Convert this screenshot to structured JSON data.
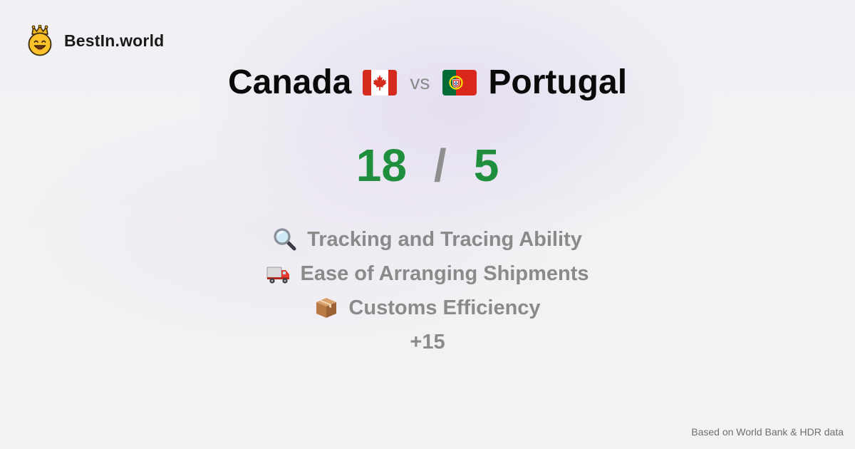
{
  "brand": {
    "name": "BestIn.world",
    "logo_icon": "crown-smiley-icon"
  },
  "comparison": {
    "country_a": {
      "name": "Canada",
      "flag_icon": "canada-flag-icon"
    },
    "vs_label": "vs",
    "country_b": {
      "name": "Portugal",
      "flag_icon": "portugal-flag-icon"
    }
  },
  "score": {
    "a": "18",
    "separator": "/",
    "b": "5"
  },
  "categories": [
    {
      "icon": "magnifying-glass-icon",
      "label": "Tracking and Tracing Ability"
    },
    {
      "icon": "delivery-truck-icon",
      "label": "Ease of Arranging Shipments"
    },
    {
      "icon": "package-box-icon",
      "label": "Customs Efficiency"
    }
  ],
  "more_label": "+15",
  "footer": {
    "source": "Based on World Bank & HDR data"
  },
  "colors": {
    "score_green": "#1f8f3d",
    "muted_gray": "#8a8a8a",
    "title_black": "#0a0a0a"
  }
}
